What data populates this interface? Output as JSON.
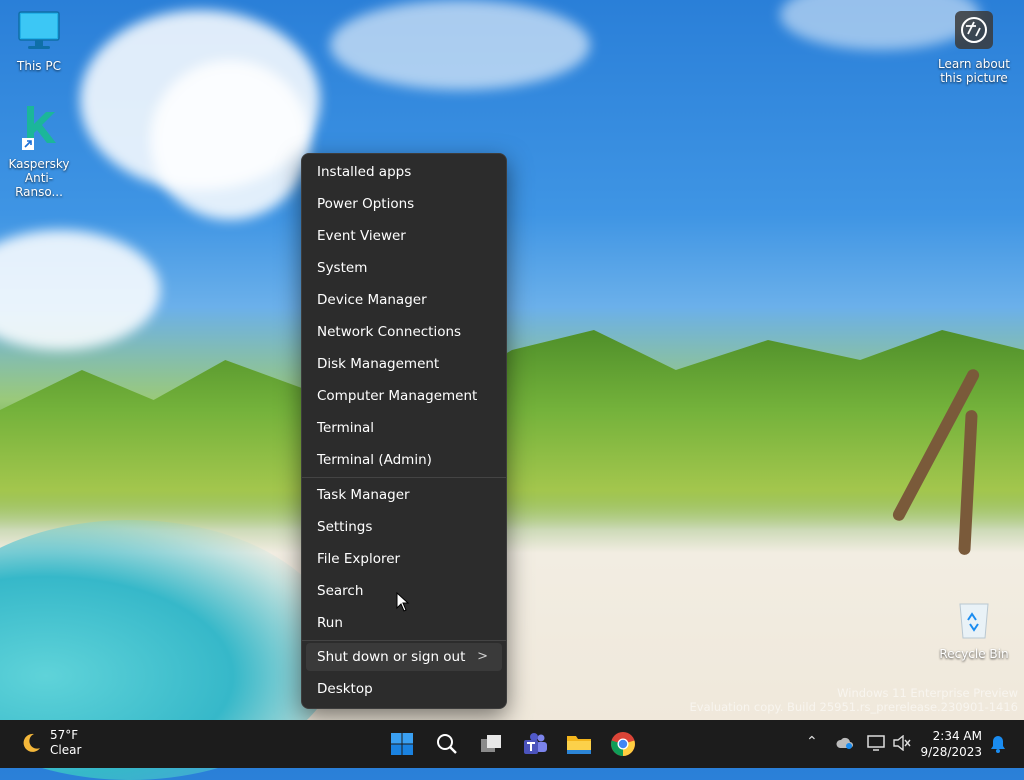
{
  "desktop": {
    "icons": [
      {
        "label": "This PC"
      },
      {
        "label": "Kaspersky Anti-Ranso..."
      },
      {
        "label": "Learn about this picture"
      },
      {
        "label": "Recycle Bin"
      }
    ],
    "watermark": {
      "line1": "Windows 11 Enterprise Preview",
      "line2": "Evaluation copy. Build 25951.rs_prerelease.230901-1416"
    }
  },
  "context_menu": {
    "items": [
      {
        "label": "Installed apps"
      },
      {
        "label": "Power Options"
      },
      {
        "label": "Event Viewer"
      },
      {
        "label": "System"
      },
      {
        "label": "Device Manager"
      },
      {
        "label": "Network Connections"
      },
      {
        "label": "Disk Management"
      },
      {
        "label": "Computer Management"
      },
      {
        "label": "Terminal"
      },
      {
        "label": "Terminal (Admin)"
      },
      {
        "label": "Task Manager"
      },
      {
        "label": "Settings"
      },
      {
        "label": "File Explorer"
      },
      {
        "label": "Search"
      },
      {
        "label": "Run"
      },
      {
        "label": "Shut down or sign out"
      },
      {
        "label": "Desktop"
      }
    ],
    "submenu_chevron": ">"
  },
  "taskbar": {
    "weather": {
      "temp": "57°F",
      "condition": "Clear",
      "icon": "moon-icon"
    },
    "apps": [
      "start-icon",
      "search-icon",
      "task-view-icon",
      "teams-icon",
      "file-explorer-icon",
      "chrome-icon"
    ],
    "clock": {
      "time": "2:34 AM",
      "date": "9/28/2023"
    }
  },
  "colors": {
    "menu_bg": "#2c2c2c",
    "taskbar_bg": "#1c1c1c",
    "accent": "#1a8cf0"
  }
}
